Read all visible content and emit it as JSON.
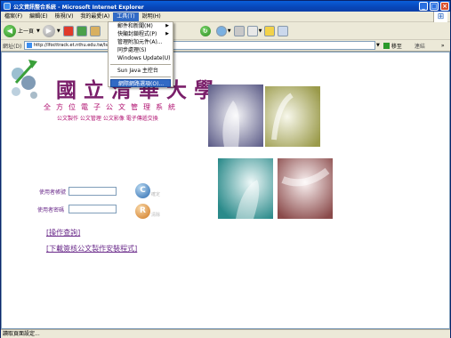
{
  "window": {
    "title": "公文資訊整合系統 - Microsoft Internet Explorer"
  },
  "menubar": {
    "items": [
      "檔案(F)",
      "編輯(E)",
      "檢視(V)",
      "我的最愛(A)",
      "工具(T)",
      "說明(H)"
    ]
  },
  "toolbar": {
    "back_label": "上一頁"
  },
  "address": {
    "label": "網址(D)",
    "url": "http://lfocttrack.et.nthu.edu.tw/lsfbed/w",
    "go_label": "移至",
    "links_label": "連結"
  },
  "tools_menu": {
    "items": [
      "郵件和新聞(M)",
      "快顯封鎖程式(P)",
      "管理附加元件(A)...",
      "同步處理(S)",
      "Windows Update(U)",
      "Sun Java 主控台",
      "網際網路選項(O)..."
    ],
    "selected": "網際網路選項(O)..."
  },
  "page": {
    "title": "國立清華大學",
    "slogan": "全方位電子公文管理系統",
    "subtitles": "公文製作  公文管理  公文影像  電子傳遞交換",
    "username_label": "使用者帳號",
    "password_label": "使用者密碼",
    "confirm_text": "確定",
    "reset_text": "清除",
    "link_manual": "[操作查詢]",
    "link_download": "[下載簽核公文製作安裝程式]"
  },
  "statusbar": {
    "text": "讀取頁面設定..."
  }
}
